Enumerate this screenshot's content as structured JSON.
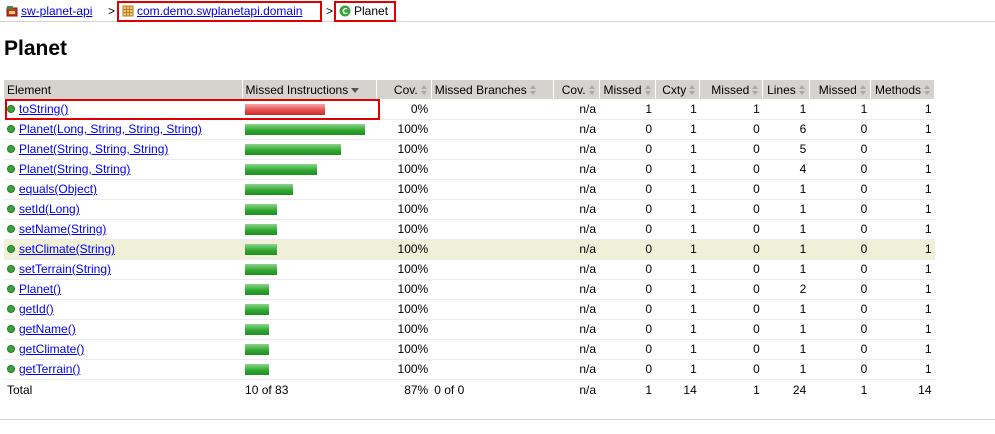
{
  "breadcrumb": {
    "session": "sw-planet-api",
    "package": "com.demo.swplanetapi.domain",
    "class": "Planet",
    "separator": ">"
  },
  "page_title": "Planet",
  "table": {
    "headers": {
      "element": "Element",
      "missed_instructions": "Missed Instructions",
      "cov": "Cov.",
      "missed_branches": "Missed Branches",
      "cov2": "Cov.",
      "missed_cxty": "Missed",
      "cxty": "Cxty",
      "missed_lines": "Missed",
      "lines": "Lines",
      "missed_methods": "Missed",
      "methods": "Methods"
    },
    "rows": [
      {
        "name": "toString()",
        "bar": "red",
        "bar_fraction": 0.67,
        "cov": "0%",
        "branch_cov": "n/a",
        "missed_cxty": "1",
        "cxty": "1",
        "missed_lines": "1",
        "lines": "1",
        "missed_methods": "1",
        "methods": "1"
      },
      {
        "name": "Planet(Long, String, String, String)",
        "bar": "green",
        "bar_fraction": 1.0,
        "cov": "100%",
        "branch_cov": "n/a",
        "missed_cxty": "0",
        "cxty": "1",
        "missed_lines": "0",
        "lines": "6",
        "missed_methods": "0",
        "methods": "1"
      },
      {
        "name": "Planet(String, String, String)",
        "bar": "green",
        "bar_fraction": 0.8,
        "cov": "100%",
        "branch_cov": "n/a",
        "missed_cxty": "0",
        "cxty": "1",
        "missed_lines": "0",
        "lines": "5",
        "missed_methods": "0",
        "methods": "1"
      },
      {
        "name": "Planet(String, String)",
        "bar": "green",
        "bar_fraction": 0.6,
        "cov": "100%",
        "branch_cov": "n/a",
        "missed_cxty": "0",
        "cxty": "1",
        "missed_lines": "0",
        "lines": "4",
        "missed_methods": "0",
        "methods": "1"
      },
      {
        "name": "equals(Object)",
        "bar": "green",
        "bar_fraction": 0.4,
        "cov": "100%",
        "branch_cov": "n/a",
        "missed_cxty": "0",
        "cxty": "1",
        "missed_lines": "0",
        "lines": "1",
        "missed_methods": "0",
        "methods": "1"
      },
      {
        "name": "setId(Long)",
        "bar": "green",
        "bar_fraction": 0.27,
        "cov": "100%",
        "branch_cov": "n/a",
        "missed_cxty": "0",
        "cxty": "1",
        "missed_lines": "0",
        "lines": "1",
        "missed_methods": "0",
        "methods": "1"
      },
      {
        "name": "setName(String)",
        "bar": "green",
        "bar_fraction": 0.27,
        "cov": "100%",
        "branch_cov": "n/a",
        "missed_cxty": "0",
        "cxty": "1",
        "missed_lines": "0",
        "lines": "1",
        "missed_methods": "0",
        "methods": "1"
      },
      {
        "name": "setClimate(String)",
        "bar": "green",
        "bar_fraction": 0.27,
        "cov": "100%",
        "branch_cov": "n/a",
        "missed_cxty": "0",
        "cxty": "1",
        "missed_lines": "0",
        "lines": "1",
        "missed_methods": "0",
        "methods": "1",
        "highlighted": true
      },
      {
        "name": "setTerrain(String)",
        "bar": "green",
        "bar_fraction": 0.27,
        "cov": "100%",
        "branch_cov": "n/a",
        "missed_cxty": "0",
        "cxty": "1",
        "missed_lines": "0",
        "lines": "1",
        "missed_methods": "0",
        "methods": "1"
      },
      {
        "name": "Planet()",
        "bar": "green",
        "bar_fraction": 0.2,
        "cov": "100%",
        "branch_cov": "n/a",
        "missed_cxty": "0",
        "cxty": "1",
        "missed_lines": "0",
        "lines": "2",
        "missed_methods": "0",
        "methods": "1"
      },
      {
        "name": "getId()",
        "bar": "green",
        "bar_fraction": 0.2,
        "cov": "100%",
        "branch_cov": "n/a",
        "missed_cxty": "0",
        "cxty": "1",
        "missed_lines": "0",
        "lines": "1",
        "missed_methods": "0",
        "methods": "1"
      },
      {
        "name": "getName()",
        "bar": "green",
        "bar_fraction": 0.2,
        "cov": "100%",
        "branch_cov": "n/a",
        "missed_cxty": "0",
        "cxty": "1",
        "missed_lines": "0",
        "lines": "1",
        "missed_methods": "0",
        "methods": "1"
      },
      {
        "name": "getClimate()",
        "bar": "green",
        "bar_fraction": 0.2,
        "cov": "100%",
        "branch_cov": "n/a",
        "missed_cxty": "0",
        "cxty": "1",
        "missed_lines": "0",
        "lines": "1",
        "missed_methods": "0",
        "methods": "1"
      },
      {
        "name": "getTerrain()",
        "bar": "green",
        "bar_fraction": 0.2,
        "cov": "100%",
        "branch_cov": "n/a",
        "missed_cxty": "0",
        "cxty": "1",
        "missed_lines": "0",
        "lines": "1",
        "missed_methods": "0",
        "methods": "1"
      }
    ],
    "total": {
      "label": "Total",
      "missed_instructions": "10 of 83",
      "cov": "87%",
      "missed_branches": "0 of 0",
      "branch_cov": "n/a",
      "missed_cxty": "1",
      "cxty": "14",
      "missed_lines": "1",
      "lines": "24",
      "missed_methods": "1",
      "methods": "14"
    }
  },
  "colors": {
    "header_bg": "#d6d3ce",
    "highlight_row": "#f0f0d8",
    "annotation_red": "#e00000",
    "link": "#0000ee"
  },
  "icons": {
    "session": "session-icon",
    "package": "package-icon",
    "class": "class-icon",
    "method": "method-icon"
  }
}
